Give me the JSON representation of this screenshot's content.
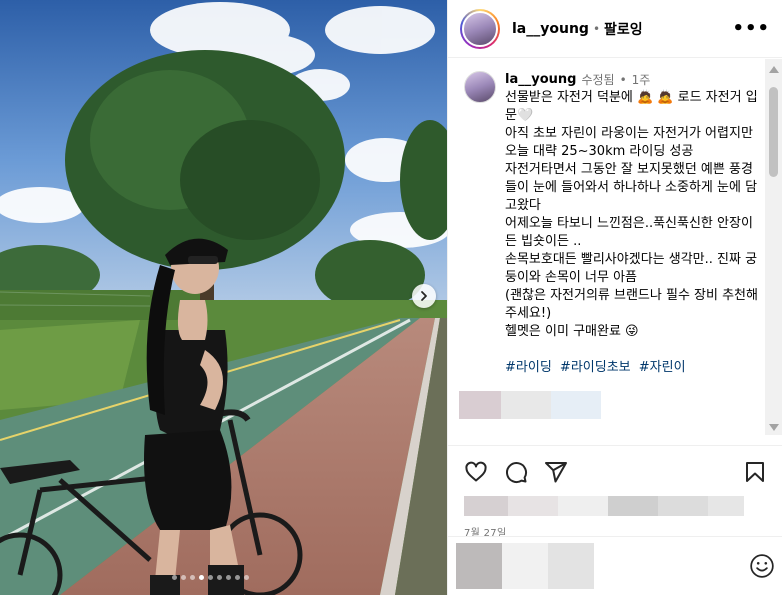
{
  "post": {
    "username": "la__young",
    "separator": "•",
    "follow_label": "팔로잉",
    "more_label": "•••",
    "edited_label": "수정됨",
    "dot": "•",
    "time_ago": "1주",
    "caption": "선물받은 자전거 덕분에 🙇 🙇 로드 자전거 입문🤍\n아직 초보 자린이 라웅이는 자전거가 어렵지만\n오늘 대략 25~30km 라이딩 성공\n자전거타면서 그동안 잘 보지못했던 예쁜 풍경들이 눈에 들어와서 하나하나 소중하게 눈에 담고왔다\n어제오늘 타보니 느낀점은..푹신푹신한 안장이든 빕숏이든 ..\n손목보호대든 빨리사야겠다는 생각만.. 진짜 궁둥이와 손목이 너무 아픔\n(괜찮은 자전거의류 브랜드나 필수 장비 추천해주세요!)\n헬멧은 이미 구매완료 😜",
    "hashtags": [
      "#라이딩",
      "#라이딩초보",
      "#자린이"
    ],
    "date": "7월 27일"
  },
  "carousel": {
    "total": 9,
    "active_index": 3
  },
  "icons": {
    "like": "heart-icon",
    "comment": "comment-icon",
    "share": "send-icon",
    "save": "bookmark-icon",
    "emoji": "emoji-icon",
    "next": "chevron-right-icon"
  },
  "colors": {
    "link": "#00376b",
    "muted": "#737373",
    "divider": "#efefef"
  }
}
